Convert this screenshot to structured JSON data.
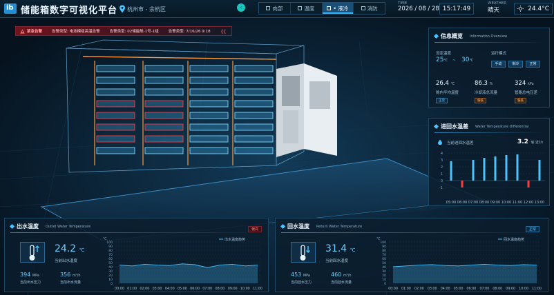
{
  "header": {
    "logo_text": "ib",
    "title": "储能箱数字可视化平台",
    "location": "杭州市 - 余杭区",
    "tabs": [
      {
        "label": "肉部",
        "active": false
      },
      {
        "label": "温度",
        "active": false
      },
      {
        "label": "• 液冷",
        "active": true
      },
      {
        "label": "消防",
        "active": false
      }
    ],
    "time_label": "TIME",
    "date": "2026 / 08 / 28",
    "clock": "15:17:49",
    "weather_label": "WEATHER",
    "weather": "晴天",
    "temperature": "24.4°C"
  },
  "alert": {
    "label": "紧急告警",
    "items": [
      "告警类型: 电池模组高温告警",
      "告警类型: 02储能舱-1号-1组",
      "告警类型: 7/16/26 9:18"
    ],
    "more": "《《"
  },
  "info_panel": {
    "title": "信息概览",
    "subtitle": "Information Overview",
    "set_temp_label": "设定温度",
    "set_temp_low": "25",
    "set_temp_high": "30",
    "temp_unit": "℃",
    "mode_label": "运行模式",
    "modes": [
      "手动",
      "制冷",
      "正常"
    ],
    "metrics": [
      {
        "value": "26.4",
        "unit": "℃",
        "label": "舱内平均温度",
        "tag": "正常",
        "tag_type": "normal"
      },
      {
        "value": "86.3",
        "unit": "%",
        "label": "冷却液总流量",
        "tag": "偏低",
        "tag_type": "warn"
      },
      {
        "value": "324",
        "unit": "kPa",
        "label": "管路总电压差",
        "tag": "偏低",
        "tag_type": "warn"
      }
    ]
  },
  "diff_panel": {
    "title": "进回水温差",
    "subtitle": "Water Temperature Differential",
    "current_label": "当前进回水温差",
    "current_value": "3.2",
    "current_unit": "℃",
    "refresh": "◎ 近1h"
  },
  "outlet_panel": {
    "title": "出水温度",
    "subtitle": "Outlet Water Temperature",
    "status": "偏高",
    "status_type": "warn",
    "temp_value": "24.2",
    "temp_unit": "℃",
    "temp_label": "当前出水温度",
    "pressure_value": "394",
    "pressure_unit": "MPa",
    "pressure_label": "当前出水压力",
    "flow_value": "356",
    "flow_unit": "m³/h",
    "flow_label": "当前出水流量",
    "legend": "出水温度趋势"
  },
  "return_panel": {
    "title": "回水温度",
    "subtitle": "Return Water Temperature",
    "status": "正常",
    "status_type": "normal",
    "temp_value": "31.4",
    "temp_unit": "℃",
    "temp_label": "当前回水温度",
    "pressure_value": "453",
    "pressure_unit": "MPa",
    "pressure_label": "当前回水压力",
    "flow_value": "460",
    "flow_unit": "m³/h",
    "flow_label": "当前回水流量",
    "legend": "回水温度趋势"
  },
  "chart_data": [
    {
      "type": "bar",
      "title": "进回水温差",
      "ylabel": "",
      "ylim": [
        -2,
        4
      ],
      "yticks": [
        -1,
        0,
        1,
        2,
        3,
        4
      ],
      "categories": [
        "05:00",
        "06:00",
        "07:00",
        "08:00",
        "09:00",
        "10:00",
        "11:00",
        "12:00",
        "13:00"
      ],
      "values": [
        2.8,
        -1.0,
        3.0,
        3.3,
        3.5,
        3.7,
        3.8,
        -1.0,
        3.0
      ]
    },
    {
      "type": "area",
      "title": "出水温度趋势",
      "ylabel": "℃",
      "ylim": [
        0,
        100
      ],
      "yticks": [
        0,
        10,
        20,
        30,
        40,
        50,
        60,
        70,
        80,
        90,
        100
      ],
      "categories": [
        "00:00",
        "01:00",
        "02:00",
        "03:00",
        "04:00",
        "05:00",
        "06:00",
        "07:00",
        "08:00",
        "09:00",
        "10:00",
        "11:00"
      ],
      "values": [
        44,
        42,
        46,
        44,
        43,
        47,
        45,
        38,
        44,
        46,
        42,
        44
      ]
    },
    {
      "type": "area",
      "title": "回水温度趋势",
      "ylabel": "℃",
      "ylim": [
        0,
        100
      ],
      "yticks": [
        0,
        10,
        20,
        30,
        40,
        50,
        60,
        70,
        80,
        90,
        100
      ],
      "categories": [
        "00:00",
        "01:00",
        "02:00",
        "03:00",
        "04:00",
        "05:00",
        "06:00",
        "07:00",
        "08:00",
        "09:00",
        "10:00",
        "11:00"
      ],
      "values": [
        40,
        42,
        44,
        45,
        43,
        42,
        44,
        46,
        44,
        43,
        45,
        44
      ]
    }
  ],
  "colors": {
    "accent": "#38b4ff",
    "bar_positive": "#4cc3ff",
    "bar_negative": "#ff3b3b",
    "warn": "#ff7b7b"
  }
}
